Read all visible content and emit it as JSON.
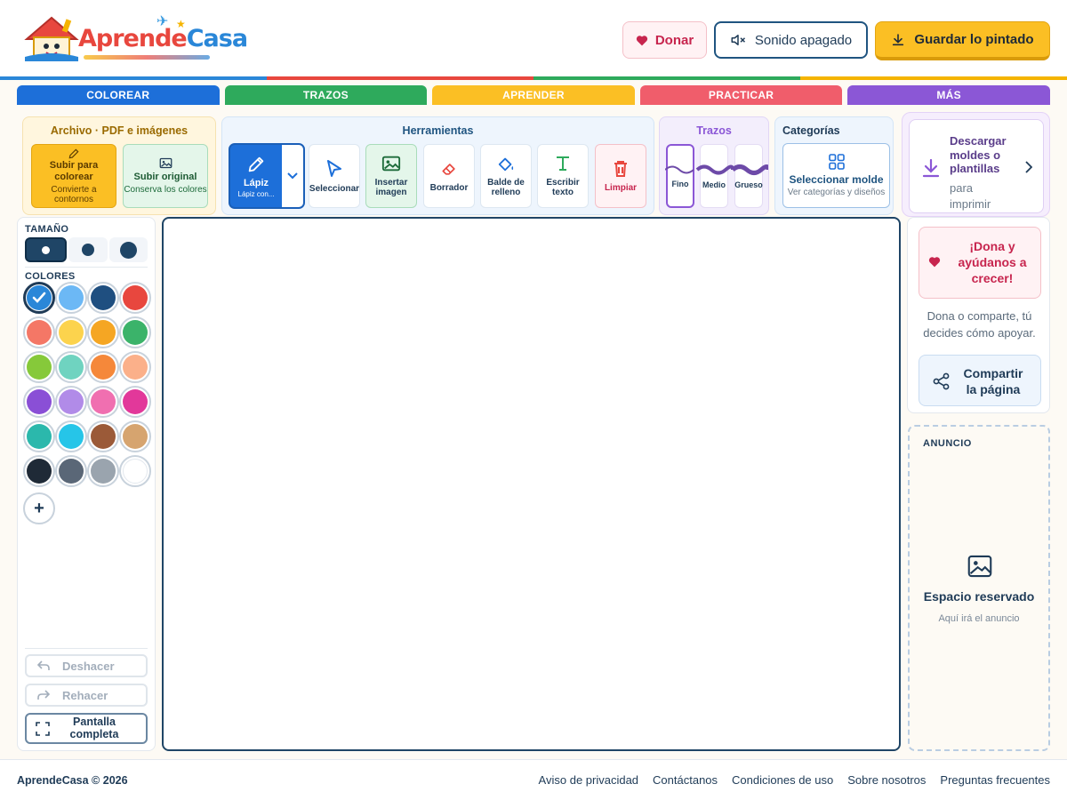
{
  "brand": {
    "part1": "Aprende",
    "part2": "Casa"
  },
  "header": {
    "donate_label": "Donar",
    "sound_label": "Sonido apagado",
    "save_label": "Guardar lo pintado"
  },
  "rainbow_colors": [
    "#2a87d8",
    "#e8473e",
    "#2eaa5c",
    "#f5b400"
  ],
  "tabs": [
    {
      "label": "COLOREAR",
      "color": "#1d6fd9"
    },
    {
      "label": "TRAZOS",
      "color": "#2eaa5c"
    },
    {
      "label": "APRENDER",
      "color": "#fbbf24"
    },
    {
      "label": "PRACTICAR",
      "color": "#f05d6b"
    },
    {
      "label": "MÁS",
      "color": "#8b57d6"
    }
  ],
  "archivo": {
    "title": "Archivo · PDF e imágenes",
    "upload_color": {
      "title": "Subir para colorear",
      "sub": "Convierte a contornos"
    },
    "upload_original": {
      "title": "Subir original",
      "sub": "Conserva los colores"
    }
  },
  "herramientas": {
    "title": "Herramientas",
    "pencil": {
      "label": "Lápiz",
      "sub": "Lápiz con..."
    },
    "tools": [
      {
        "key": "seleccionar",
        "label": "Seleccionar",
        "icon": "cursor-icon"
      },
      {
        "key": "insertar",
        "label": "Insertar imagen",
        "icon": "image-icon"
      },
      {
        "key": "borrador",
        "label": "Borrador",
        "icon": "eraser-icon"
      },
      {
        "key": "balde",
        "label": "Balde de relleno",
        "icon": "paint-bucket-icon"
      },
      {
        "key": "texto",
        "label": "Escribir texto",
        "icon": "text-icon"
      },
      {
        "key": "limpiar",
        "label": "Limpiar",
        "icon": "trash-icon"
      }
    ]
  },
  "trazos": {
    "title": "Trazos",
    "options": [
      "Fino",
      "Medio",
      "Grueso"
    ],
    "selected": "Fino"
  },
  "categorias": {
    "title": "Categorías",
    "button_title": "Seleccionar molde",
    "button_sub": "Ver categorías y diseños"
  },
  "descargar": {
    "title": "Descargar moldes o plantillas",
    "sub": "para imprimir"
  },
  "sidebar": {
    "size_label": "TAMAÑO",
    "sizes": [
      "small",
      "medium",
      "large"
    ],
    "selected_size": "small",
    "colors_label": "COLORES",
    "colors": [
      "#2a87d8",
      "#6cb8f5",
      "#1f4f80",
      "#e8473e",
      "#f47766",
      "#fcd34d",
      "#f5a623",
      "#3bb36a",
      "#86c93a",
      "#6fd3c0",
      "#f5883a",
      "#fbb08a",
      "#8a4fd6",
      "#b18be8",
      "#f06fb0",
      "#e2389a",
      "#2bb8ac",
      "#26c5e8",
      "#9b5a38",
      "#d6a46f",
      "#1f2a37",
      "#5a6777",
      "#9aa4ae",
      "#ffffff"
    ],
    "selected_color": "#2a87d8",
    "add_color": "+",
    "undo_label": "Deshacer",
    "redo_label": "Rehacer",
    "fullscreen_label": "Pantalla completa"
  },
  "right": {
    "donate_title": "¡Dona y ayúdanos a crecer!",
    "donate_sub": "Dona o comparte, tú decides cómo apoyar.",
    "share_label": "Compartir la página"
  },
  "ad": {
    "label": "ANUNCIO",
    "title": "Espacio reservado",
    "sub": "Aquí irá el anuncio"
  },
  "footer": {
    "copyright": "AprendeCasa © 2026",
    "links": [
      "Aviso de privacidad",
      "Contáctanos",
      "Condiciones de uso",
      "Sobre nosotros",
      "Preguntas frecuentes"
    ]
  }
}
